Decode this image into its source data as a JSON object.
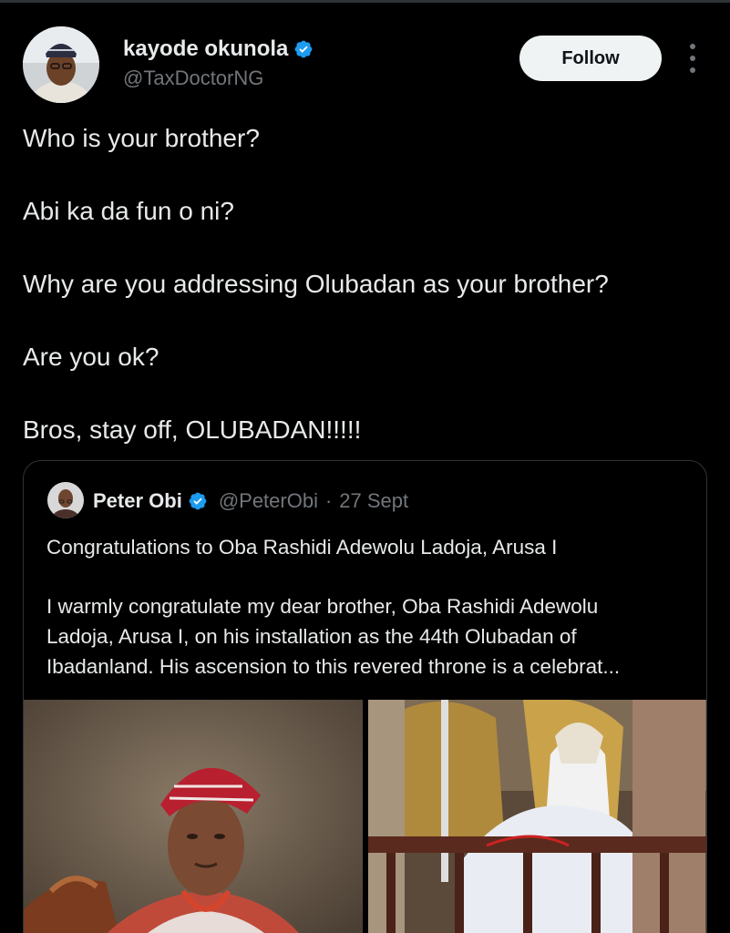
{
  "post": {
    "author": {
      "name": "kayode okunola",
      "handle": "@TaxDoctorNG",
      "verified": true
    },
    "follow_label": "Follow",
    "text_lines": [
      "Who is your brother?",
      "Abi ka da fun o ni?",
      "Why are you addressing Olubadan as your brother?",
      "Are you ok?",
      "Bros, stay off, OLUBADAN!!!!!"
    ]
  },
  "quote": {
    "author": {
      "name": "Peter Obi",
      "handle": "@PeterObi",
      "verified": true
    },
    "separator": "·",
    "date": "27 Sept",
    "text_lines": [
      "Congratulations to Oba Rashidi Adewolu Ladoja, Arusa I",
      "I warmly congratulate my dear brother, Oba Rashidi Adewolu",
      "Ladoja, Arusa I, on his installation as the 44th Olubadan of",
      "Ibadanland. His ascension to this revered throne is a celebrat..."
    ],
    "media": [
      "portrait-photo",
      "ceremony-photo"
    ]
  },
  "colors": {
    "background": "#000000",
    "text": "#e7e9ea",
    "secondary_text": "#71767b",
    "verified_blue": "#1d9bf0",
    "follow_button_bg": "#eff3f4",
    "border": "#2f3336"
  },
  "icons": [
    "verified-badge-icon",
    "more-options-icon"
  ]
}
